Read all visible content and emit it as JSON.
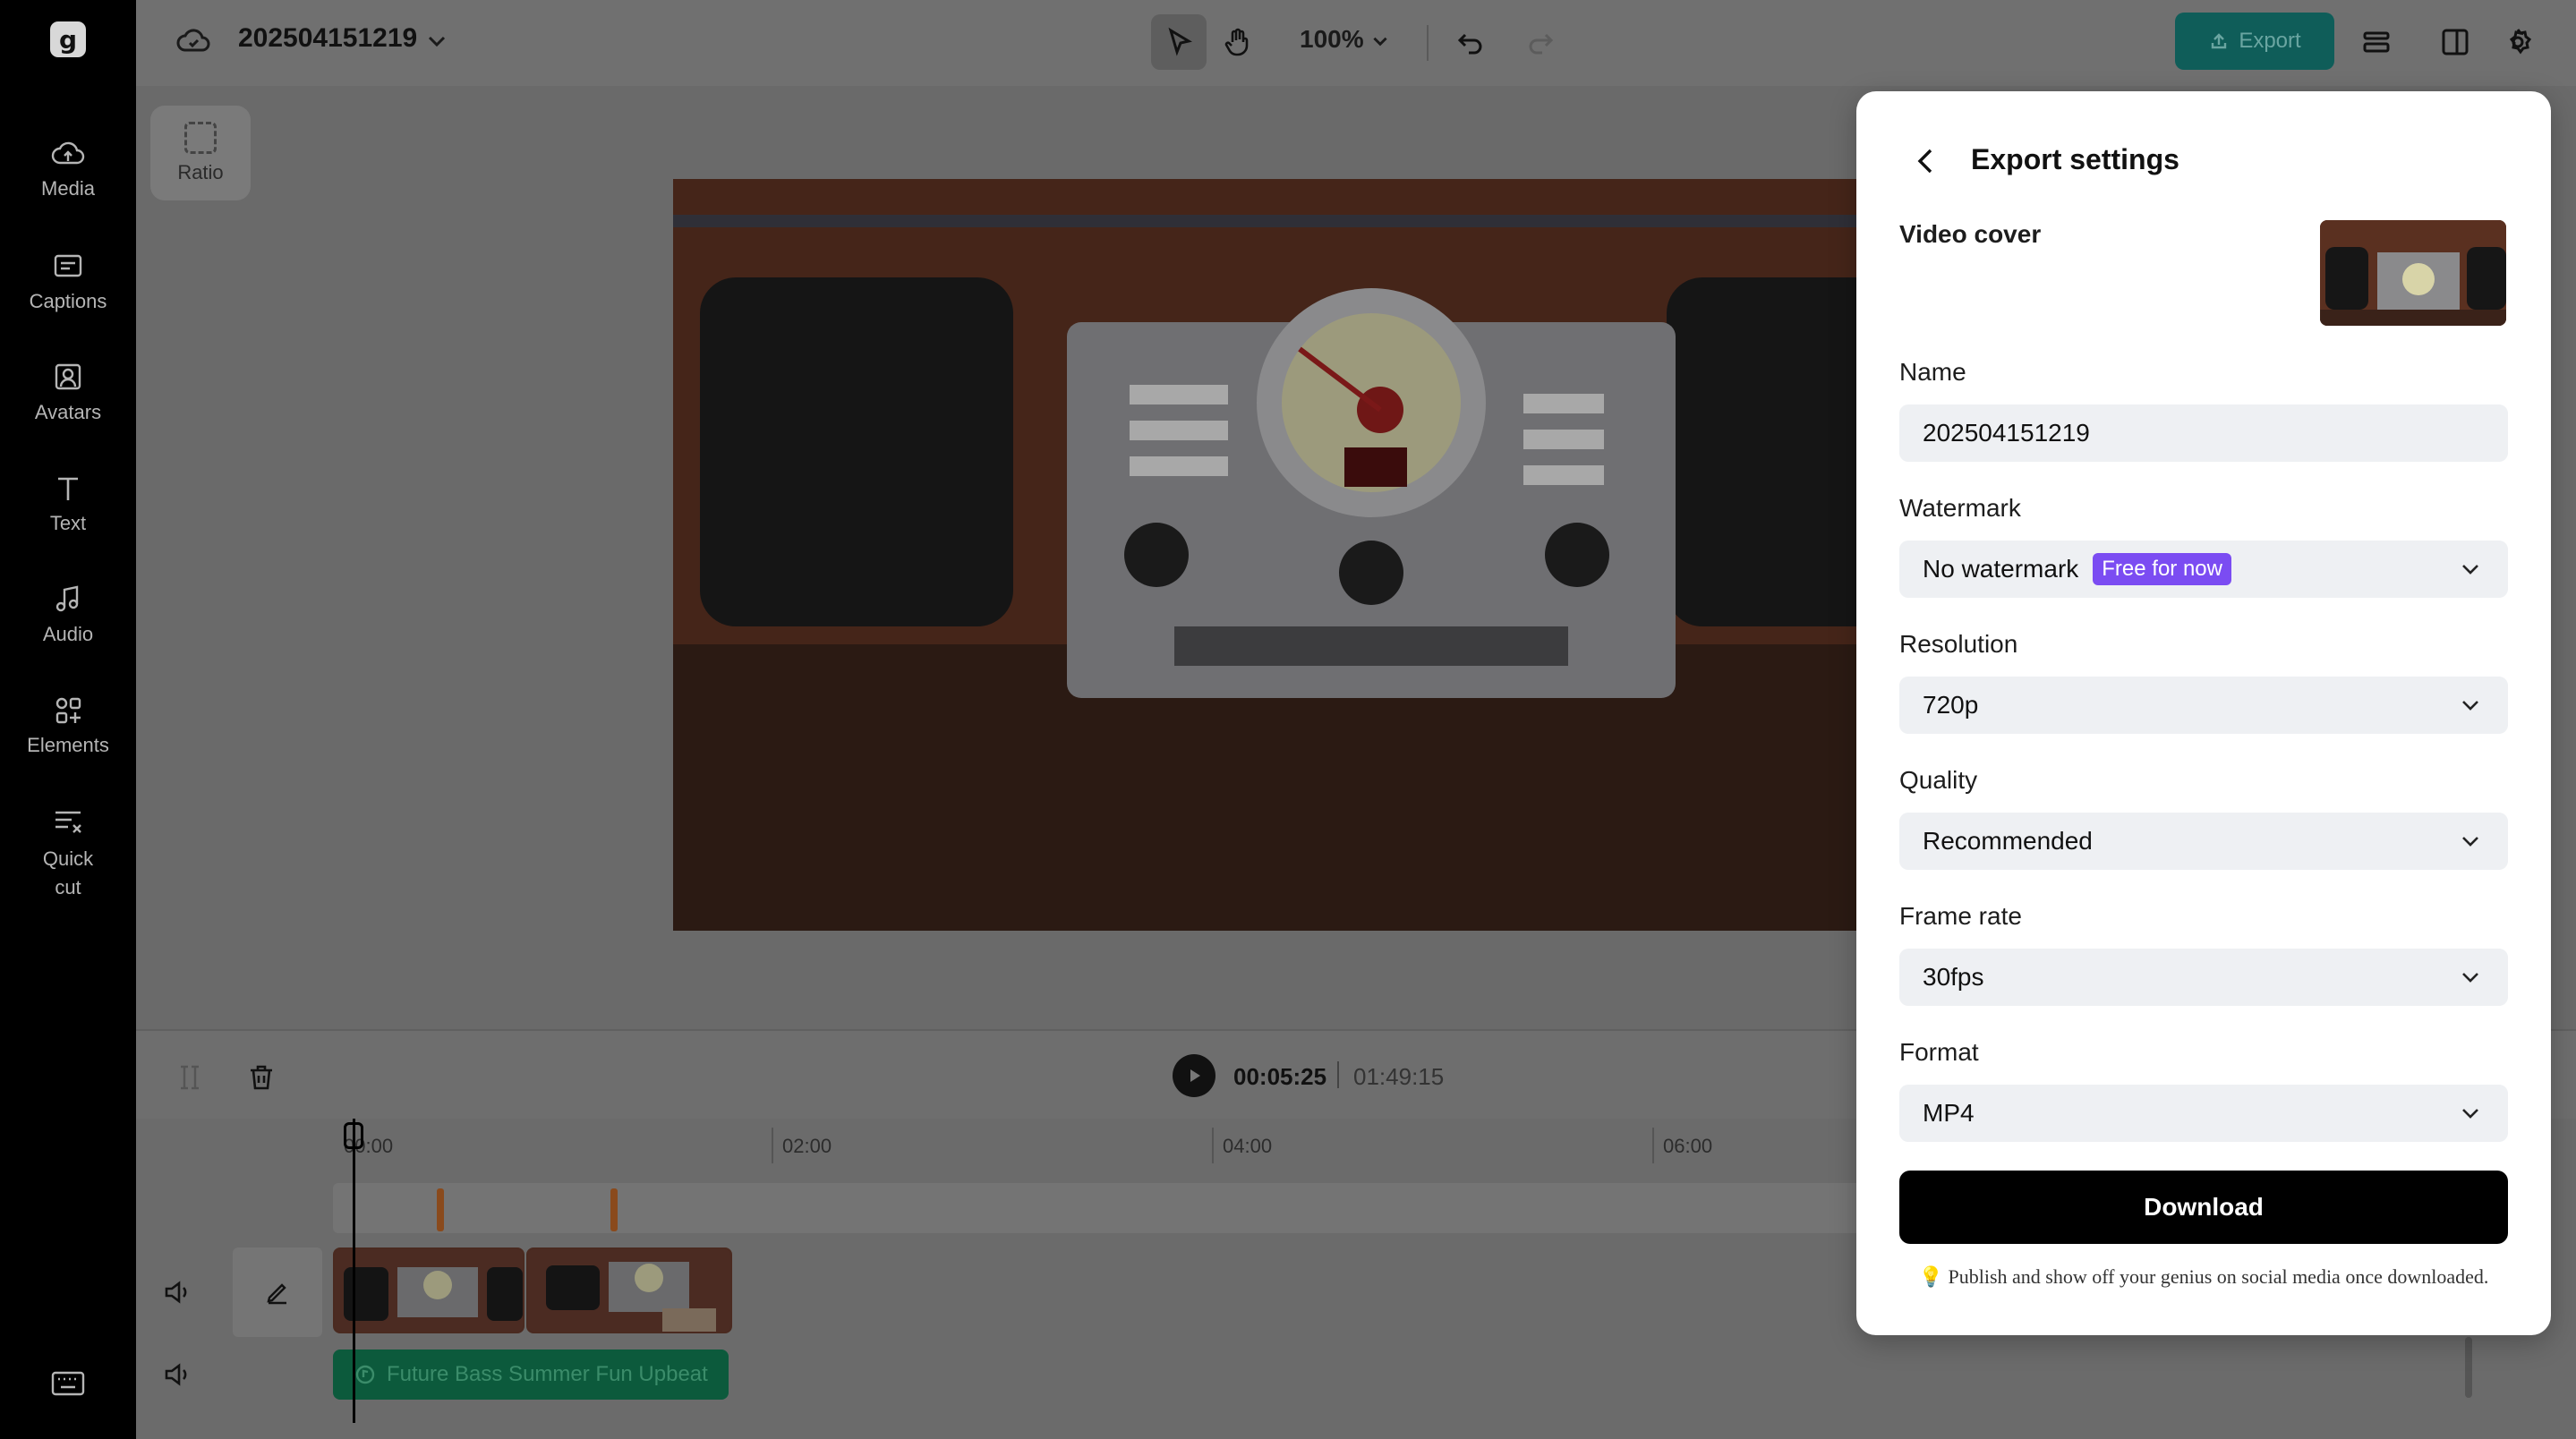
{
  "sidebar": {
    "items": [
      {
        "label": "Media",
        "icon": "cloud-upload-icon"
      },
      {
        "label": "Captions",
        "icon": "captions-icon"
      },
      {
        "label": "Avatars",
        "icon": "avatar-icon"
      },
      {
        "label": "Text",
        "icon": "text-icon"
      },
      {
        "label": "Audio",
        "icon": "music-note-icon"
      },
      {
        "label": "Elements",
        "icon": "elements-icon"
      },
      {
        "label": "Quick cut",
        "icon": "quick-cut-icon"
      }
    ]
  },
  "topbar": {
    "project_name": "202504151219",
    "zoom": "100%",
    "export_label": "Export"
  },
  "canvas": {
    "ratio_label": "Ratio"
  },
  "playback": {
    "current_time": "00:05:25",
    "total_time": "01:49:15"
  },
  "timeline": {
    "ruler_labels": [
      "00:00",
      "02:00",
      "04:00",
      "06:00"
    ],
    "audio_track_name": "Future Bass Summer Fun Upbeat"
  },
  "export_panel": {
    "title": "Export settings",
    "video_cover_label": "Video cover",
    "name_label": "Name",
    "name_value": "202504151219",
    "watermark_label": "Watermark",
    "watermark_value": "No watermark",
    "watermark_badge": "Free for now",
    "resolution_label": "Resolution",
    "resolution_value": "720p",
    "quality_label": "Quality",
    "quality_value": "Recommended",
    "frame_rate_label": "Frame rate",
    "frame_rate_value": "30fps",
    "format_label": "Format",
    "format_value": "MP4",
    "download_label": "Download",
    "tip": "💡 Publish and show off your genius on social media once downloaded."
  },
  "colors": {
    "accent_badge": "#7b4cf2",
    "export_button": "#0f5d59",
    "download_button": "#000000",
    "audio_clip": "#0c5a3c"
  }
}
